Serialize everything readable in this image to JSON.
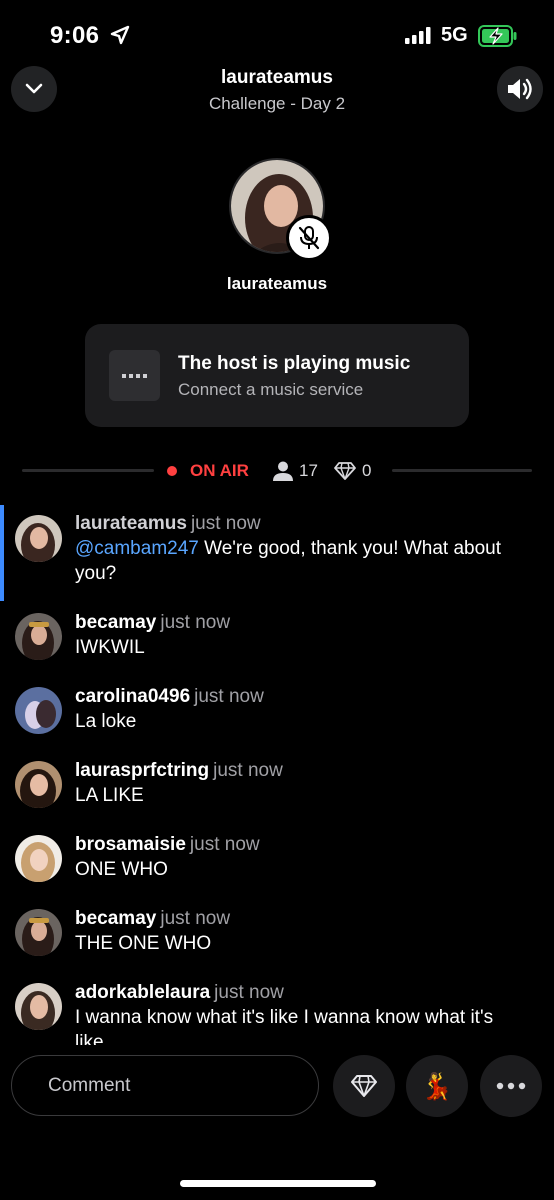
{
  "status_bar": {
    "time": "9:06",
    "network": "5G",
    "icons": [
      "location-arrow-icon",
      "signal-bars-icon",
      "battery-charging-icon"
    ]
  },
  "header": {
    "host": "laurateamus",
    "subtitle": "Challenge - Day 2",
    "left_icon": "chevron-down-icon",
    "right_icon": "speaker-icon"
  },
  "stage": {
    "host_name": "laurateamus",
    "host_muted": true,
    "mute_icon": "mic-off-icon"
  },
  "music_card": {
    "title": "The host is playing music",
    "subtitle": "Connect a music service",
    "icon": "dots-icon"
  },
  "live_bar": {
    "status": "ON AIR",
    "listeners": "17",
    "diamonds": "0",
    "colors": {
      "live": "#ff4040"
    }
  },
  "comments": [
    {
      "user": "laurateamus",
      "time": "just now",
      "mention": "@cambam247",
      "text": " We're good, thank you! What about you?",
      "avatar_color": "#8a6a5a"
    },
    {
      "user": "becamay",
      "time": "just now",
      "mention": "",
      "text": "IWKWIL",
      "avatar_color": "#5a4a45"
    },
    {
      "user": "carolina0496",
      "time": "just now",
      "mention": "",
      "text": "La loke",
      "avatar_color": "#6b6a8a"
    },
    {
      "user": "laurasprfctring",
      "time": "just now",
      "mention": "",
      "text": "LA LIKE",
      "avatar_color": "#6a4a3a"
    },
    {
      "user": "brosamaisie",
      "time": "just now",
      "mention": "",
      "text": "ONE WHO",
      "avatar_color": "#b8a080"
    },
    {
      "user": "becamay",
      "time": "just now",
      "mention": "",
      "text": "THE ONE WHO",
      "avatar_color": "#5a4a45"
    },
    {
      "user": "adorkablelaura",
      "time": "just now",
      "mention": "",
      "text": "I wanna know what it's like I wanna know what it's like",
      "avatar_color": "#7a5a4a"
    }
  ],
  "composer": {
    "placeholder": "Comment",
    "gift_icon": "diamond-icon",
    "emoji": "💃",
    "more_icon": "more-horizontal-icon"
  },
  "colors": {
    "background": "#000000",
    "card": "#1c1c1e",
    "mention": "#5aa6ff",
    "accent": "#3d8bff"
  }
}
